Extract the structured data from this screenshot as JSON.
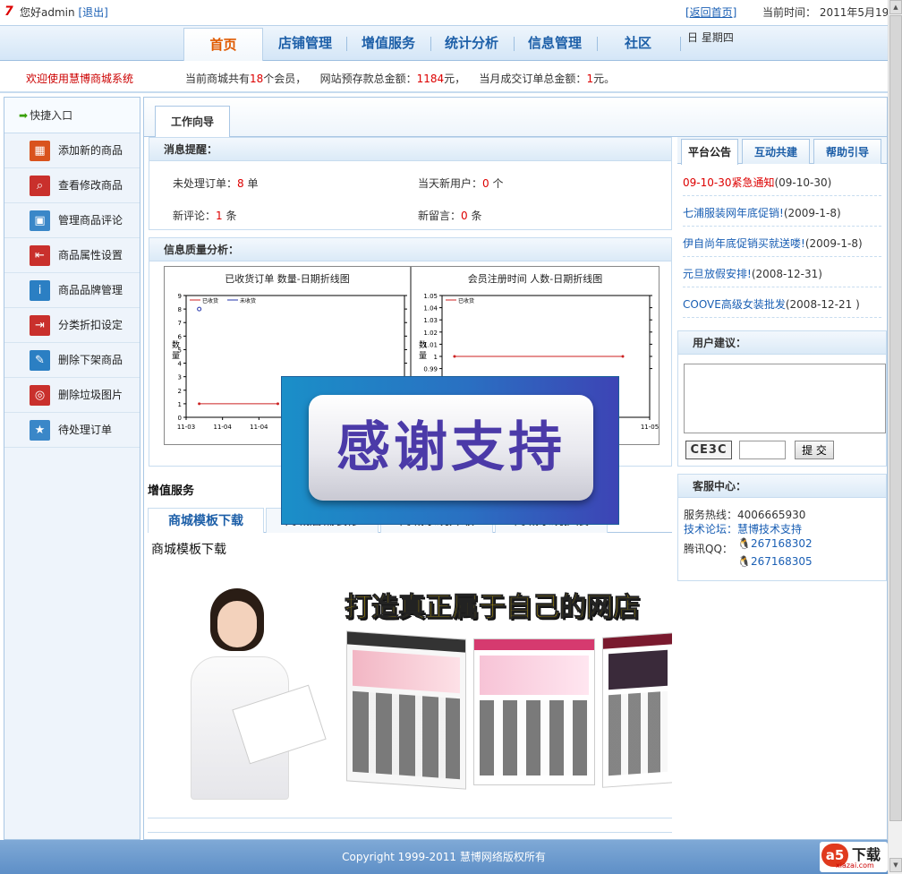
{
  "header": {
    "logo_char": "7",
    "greeting": "您好admin",
    "logout": "[退出]",
    "return_home": "[返回首页]",
    "time_text": "当前时间：  2011年5月19",
    "weekday": "日 星期四"
  },
  "nav": {
    "items": [
      {
        "label": "首页",
        "active": true
      },
      {
        "label": "店铺管理"
      },
      {
        "label": "增值服务"
      },
      {
        "label": "统计分析"
      },
      {
        "label": "信息管理"
      },
      {
        "label": "社区"
      }
    ]
  },
  "welcome": {
    "text": "欢迎使用慧博商城系统",
    "members_pre": "当前商城共有",
    "members": "18",
    "members_post": "个会员，",
    "deposit_pre": "网站预存款总金额：",
    "deposit": "1184",
    "deposit_post": "元，",
    "month_pre": "当月成交订单总金额：",
    "month": "1",
    "month_post": "元。"
  },
  "sidebar": {
    "title": "快捷入口",
    "items": [
      {
        "label": "添加新的商品",
        "icon": "table-icon",
        "color": "#d9531e"
      },
      {
        "label": "查看修改商品",
        "icon": "search-edit-icon",
        "color": "#c9302c"
      },
      {
        "label": "管理商品评论",
        "icon": "image-icon",
        "color": "#3a87c8"
      },
      {
        "label": "商品属性设置",
        "icon": "arrow-left-icon",
        "color": "#c9302c"
      },
      {
        "label": "商品品牌管理",
        "icon": "info-icon",
        "color": "#2b7fc3"
      },
      {
        "label": "分类折扣设定",
        "icon": "arrow-right-icon",
        "color": "#c9302c"
      },
      {
        "label": "删除下架商品",
        "icon": "pencil-icon",
        "color": "#2b7fc3"
      },
      {
        "label": "删除垃圾图片",
        "icon": "target-icon",
        "color": "#c9302c"
      },
      {
        "label": "待处理订单",
        "icon": "star-icon",
        "color": "#3a87c8"
      }
    ]
  },
  "work": {
    "tab": "工作向导",
    "msg_head": "消息提醒：",
    "pending_orders_label": "未处理订单：",
    "pending_orders": "8",
    "pending_orders_unit": " 单",
    "new_users_label": "当天新用户：",
    "new_users": "0",
    "new_users_unit": " 个",
    "new_comments_label": "新评论：",
    "new_comments": "1",
    "new_comments_unit": " 条",
    "new_messages_label": "新留言：",
    "new_messages": "0",
    "new_messages_unit": " 条",
    "quality_head": "信息质量分析："
  },
  "chart_data": [
    {
      "type": "line",
      "title": "已收货订单 数量-日期折线图",
      "ylabel": "数量",
      "ylim": [
        0,
        9
      ],
      "yticks": [
        "0",
        "1",
        "2",
        "3",
        "4",
        "5",
        "6",
        "7",
        "8",
        "9"
      ],
      "xticks": [
        "11-03",
        "11-04",
        "11-04"
      ],
      "legend": [
        "已收货",
        "未收货"
      ],
      "series": [
        {
          "name": "已收货",
          "color": "#cc2222",
          "values": [
            1,
            1
          ]
        },
        {
          "name": "未收货",
          "color": "#2233aa",
          "points": [
            [
              0,
              8
            ]
          ]
        }
      ]
    },
    {
      "type": "line",
      "title": "会员注册时间 人数-日期折线图",
      "ylabel": "数量",
      "ylim": [
        0.95,
        1.05
      ],
      "yticks": [
        "1.05",
        "1.04",
        "1.03",
        "1.02",
        "1.01",
        "1",
        "0.99"
      ],
      "xticks": [
        "11-05"
      ],
      "legend": [
        "已收货"
      ],
      "series": [
        {
          "name": "已收货",
          "color": "#cc2222",
          "values": [
            1,
            1
          ]
        }
      ]
    }
  ],
  "right": {
    "tabs": [
      "平台公告",
      "互动共建",
      "帮助引导"
    ],
    "news": [
      {
        "title": "09-10-30紧急通知",
        "date": "(09-10-30)",
        "hot": true
      },
      {
        "title": "七浦服装网年底促销!",
        "date": "(2009-1-8)"
      },
      {
        "title": "伊自尚年底促销买就送喽!",
        "date": "(2009-1-8)"
      },
      {
        "title": "元旦放假安排!",
        "date": "(2008-12-31)"
      },
      {
        "title": "COOVE高级女装批发",
        "date": "(2008-12-21 )"
      }
    ],
    "suggest_head": "用户建议：",
    "captcha": "CE3C",
    "submit": "提 交",
    "service_head": "客服中心：",
    "hotline_label": "服务热线：",
    "hotline": "4006665930",
    "forum_label": "技术论坛：",
    "forum": "慧博技术支持",
    "qq_label": "腾讯QQ：",
    "qq1": "267168302",
    "qq2": "267168305"
  },
  "services": {
    "title": "增值服务",
    "tabs": [
      "商城模板下载",
      "商城店铺装修",
      "商城系统升级",
      "商城系统扩展"
    ],
    "content_title": "商城模板下载",
    "banner_text": "打造真正属于自己的网店"
  },
  "overlay_text": "感谢支持",
  "footer": "Copyright 1999-2011 慧博网络版权所有",
  "watermark": {
    "brand": "下载",
    "site": "xiazai.com"
  }
}
